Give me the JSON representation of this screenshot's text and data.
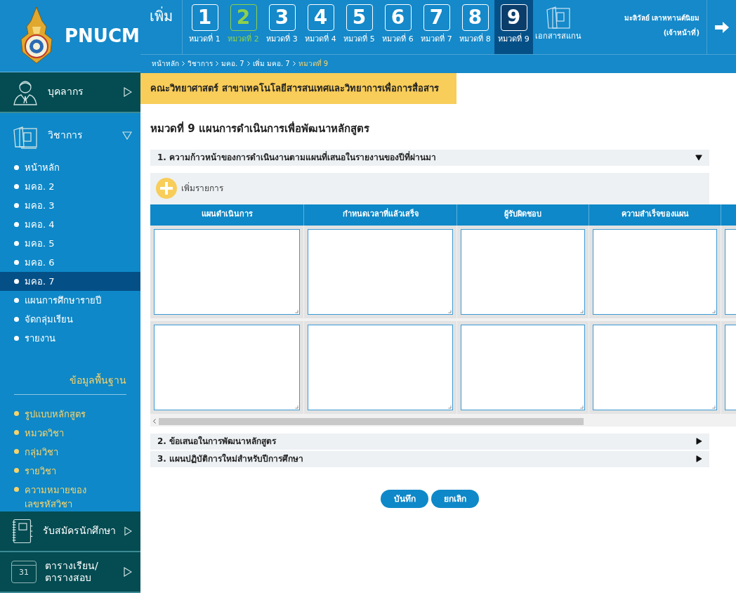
{
  "logo": {
    "title": "PNUCM"
  },
  "steps": {
    "label": "เพิ่ม",
    "items": [
      {
        "number": "1",
        "label": "หมวดที่ 1",
        "completed": false,
        "selected": false
      },
      {
        "number": "2",
        "label": "หมวดที่ 2",
        "completed": true,
        "selected": false
      },
      {
        "number": "3",
        "label": "หมวดที่ 3",
        "completed": false,
        "selected": false
      },
      {
        "number": "4",
        "label": "หมวดที่ 4",
        "completed": false,
        "selected": false
      },
      {
        "number": "5",
        "label": "หมวดที่ 5",
        "completed": false,
        "selected": false
      },
      {
        "number": "6",
        "label": "หมวดที่ 6",
        "completed": false,
        "selected": false
      },
      {
        "number": "7",
        "label": "หมวดที่ 7",
        "completed": false,
        "selected": false
      },
      {
        "number": "8",
        "label": "หมวดที่ 8",
        "completed": false,
        "selected": false
      },
      {
        "number": "9",
        "label": "หมวดที่ 9",
        "completed": false,
        "selected": true
      }
    ],
    "documents": "เอกสารสแกน"
  },
  "user": {
    "name": "มะลิวัลย์ เลาหทานต์นิยม",
    "role": "(เจ้าหน้าที่)"
  },
  "breadcrumb": [
    "หน้าหลัก",
    "วิชาการ",
    "มคอ. 7",
    "เพิ่ม มคอ. 7",
    "หมวดที่ 9"
  ],
  "sidebar": [
    {
      "kind": "person",
      "label": "บุคลากร",
      "expanded": false
    },
    {
      "kind": "folder",
      "label": "วิชาการ",
      "expanded": true,
      "items": [
        {
          "label": "หน้าหลัก",
          "selected": false
        },
        {
          "label": "มคอ. 2",
          "selected": false
        },
        {
          "label": "มคอ. 3",
          "selected": false
        },
        {
          "label": "มคอ. 4",
          "selected": false
        },
        {
          "label": "มคอ. 5",
          "selected": false
        },
        {
          "label": "มคอ. 6",
          "selected": false
        },
        {
          "label": "มคอ. 7",
          "selected": true
        },
        {
          "label": "แผนการศึกษารายปี",
          "selected": false
        },
        {
          "label": "จัดกลุ่มเรียน",
          "selected": false
        },
        {
          "label": "รายงาน",
          "selected": false
        }
      ],
      "subheading": "ข้อมูลพื้นฐาน",
      "subitems": [
        "รูปแบบหลักสูตร",
        "หมวดวิชา",
        "กลุ่มวิชา",
        "รายวิชา",
        "ความหมายของ\nเลขรหัสวิชา"
      ]
    },
    {
      "kind": "notebook",
      "label": "รับสมัครนักศึกษา",
      "expanded": false
    },
    {
      "kind": "calendar",
      "label": "ตารางเรียน/\nตารางสอบ",
      "expanded": false,
      "icon_text": "31"
    }
  ],
  "banner": "คณะวิทยาศาสตร์ สาขาเทคโนโลยีสารสนเทศและวิทยาการเพื่อการสื่อสาร",
  "page_title": "หมวดที่ 9 แผนการดำเนินการเพื่อพัฒนาหลักสูตร",
  "sections": [
    {
      "title": "1. ความก้าวหน้าของการดำเนินงานตามแผนที่เสนอในรายงานของปีที่ผ่านมา",
      "expanded": true
    },
    {
      "title": "2. ข้อเสนอในการพัฒนาหลักสูตร",
      "expanded": false
    },
    {
      "title": "3. แผนปฏิบัติการใหม่สำหรับปีการศึกษา",
      "expanded": false
    }
  ],
  "add_item": "เพิ่มรายการ",
  "table": {
    "columns": [
      "แผนดำเนินการ",
      "กำหนดเวลาที่แล้วเสร็จ",
      "ผู้รับผิดชอบ",
      "ความสำเร็จของแผน"
    ],
    "rows": [
      {
        "cells": [
          {
            "kind": "textarea"
          },
          {
            "kind": "textarea"
          },
          {
            "kind": "textarea"
          },
          {
            "kind": "textarea"
          },
          {
            "kind": "textarea"
          }
        ]
      },
      {
        "cells": [
          {
            "kind": "textarea"
          },
          {
            "kind": "textarea"
          },
          {
            "kind": "textarea"
          },
          {
            "kind": "textarea"
          },
          {
            "kind": "textarea"
          }
        ]
      }
    ]
  },
  "buttons": [
    "บันทึก",
    "ยกเลิก"
  ]
}
